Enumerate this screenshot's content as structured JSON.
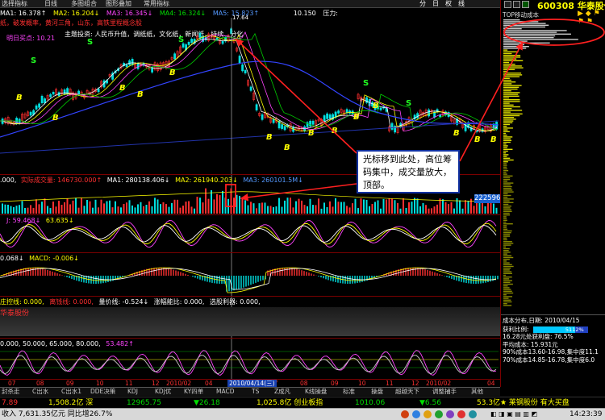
{
  "toolbar": {
    "items": [
      "选择指标",
      "日线",
      "多图组合",
      "图形叠加",
      "常用指标"
    ],
    "buttons": [
      "分",
      "日",
      "权",
      "线"
    ]
  },
  "stock": {
    "code": "600308",
    "name": "华泰股份"
  },
  "main_header": {
    "ma1": "MA1: 16.378↑",
    "ma2": "MA2: 16.204↓",
    "ma3": "MA3: 16.345↓",
    "ma4": "MA4: 16.324↓",
    "ma5": "MA5: 15.823↑",
    "price": "10.150",
    "pressure": "压力:",
    "line2": "纸，破发概率，黄河三角，山东，高铁里程概念股",
    "hint": "明日买点: 10.21",
    "theme": "主题投资: 人民币升值，调纸纸，文化纸，新闻纸，持续…分化",
    "price_marker": "17.64",
    "s_marks": [
      "S",
      "S",
      "S",
      "S",
      "S"
    ],
    "b_marks": [
      "B",
      "B",
      "B",
      "B",
      "B",
      "B",
      "B",
      "B",
      "B",
      "B",
      "B",
      "B",
      "B",
      "B"
    ]
  },
  "volume_header": {
    "a": ".000,",
    "b": "实际成交量: 146730.000↑",
    "ma1": "MA1: 280138.406↓",
    "ma2": "MA2: 261940.203↓",
    "ma3": "MA3: 260101.5M↓",
    "badge": "222596"
  },
  "kdj_header": {
    "j": "J: 59.468↓",
    "d": "63.635↓"
  },
  "macd_header": {
    "a": "0.068↓",
    "macd": "MACD: -0.006↓"
  },
  "panel5_header": {
    "a": "庄控线: 0.000,",
    "b": "离钱线: 0.000,",
    "c": "量价线: -0.524↓",
    "d": "涨幅能比: 0.000,",
    "e": "选股利器: 0.000,",
    "f": "华泰股份"
  },
  "panel6_header": {
    "a": "0.000, 50.000, 65.000, 80.000,",
    "b": "53.482↑"
  },
  "date_axis": {
    "labels": [
      "07",
      "08",
      "09",
      "10",
      "11",
      "12",
      "2010/02",
      "04",
      "07",
      "08",
      "09",
      "10",
      "11",
      "12",
      "2010/02",
      "04"
    ],
    "cursor_date": "2010/04/14(三)"
  },
  "tabs": [
    "封杀走",
    "C出水",
    "C出水1",
    "DDE决策",
    "KDJ",
    "KDJ优",
    "KY四单",
    "MACD",
    "TS",
    "Z成凡",
    "K线操盘",
    "标准",
    "操盘",
    "超越天下",
    "调整捕手",
    "其他"
  ],
  "index_bar": {
    "v1": "7.89",
    "v2": "1,508.2亿 深",
    "v3": "12965.75",
    "v4": "▼26.18",
    "v5": "1,025.8亿 创业板指",
    "v6": "1010.06",
    "v7": "▼6.56",
    "v8": "53.3亿",
    "v9": "★ 莱钢股份 有大买盘"
  },
  "status_bar": {
    "income": "收入 7,631.35亿元 同比增26.7%",
    "time": "14:23:39"
  },
  "right_panel": {
    "title": "TOP移动成本",
    "dist_title": "成本分布,日期: 2010/04/15",
    "profit_label": "获利比例:",
    "profit_value": "5112%",
    "line1": "16.28元处获利盘: 76.5%",
    "line2": "平均成本: 15.931元",
    "line3": "90%成本13.60-16.98,集中度11.1",
    "line4": "70%成本14.85-16.78,集中度6.0"
  },
  "annotation": {
    "text": "光标移到此处，高位筹码集中，成交量放大，顶部。"
  },
  "colors": {
    "up": "#ff3030",
    "down": "#00e0e0",
    "ma_white": "#ffffff",
    "ma_yellow": "#ffff00",
    "ma_magenta": "#ff44ff",
    "ma_green": "#00cc00",
    "ma_blue": "#3344ff",
    "accent": "#ffff00",
    "arrow": "#ff2020"
  }
}
